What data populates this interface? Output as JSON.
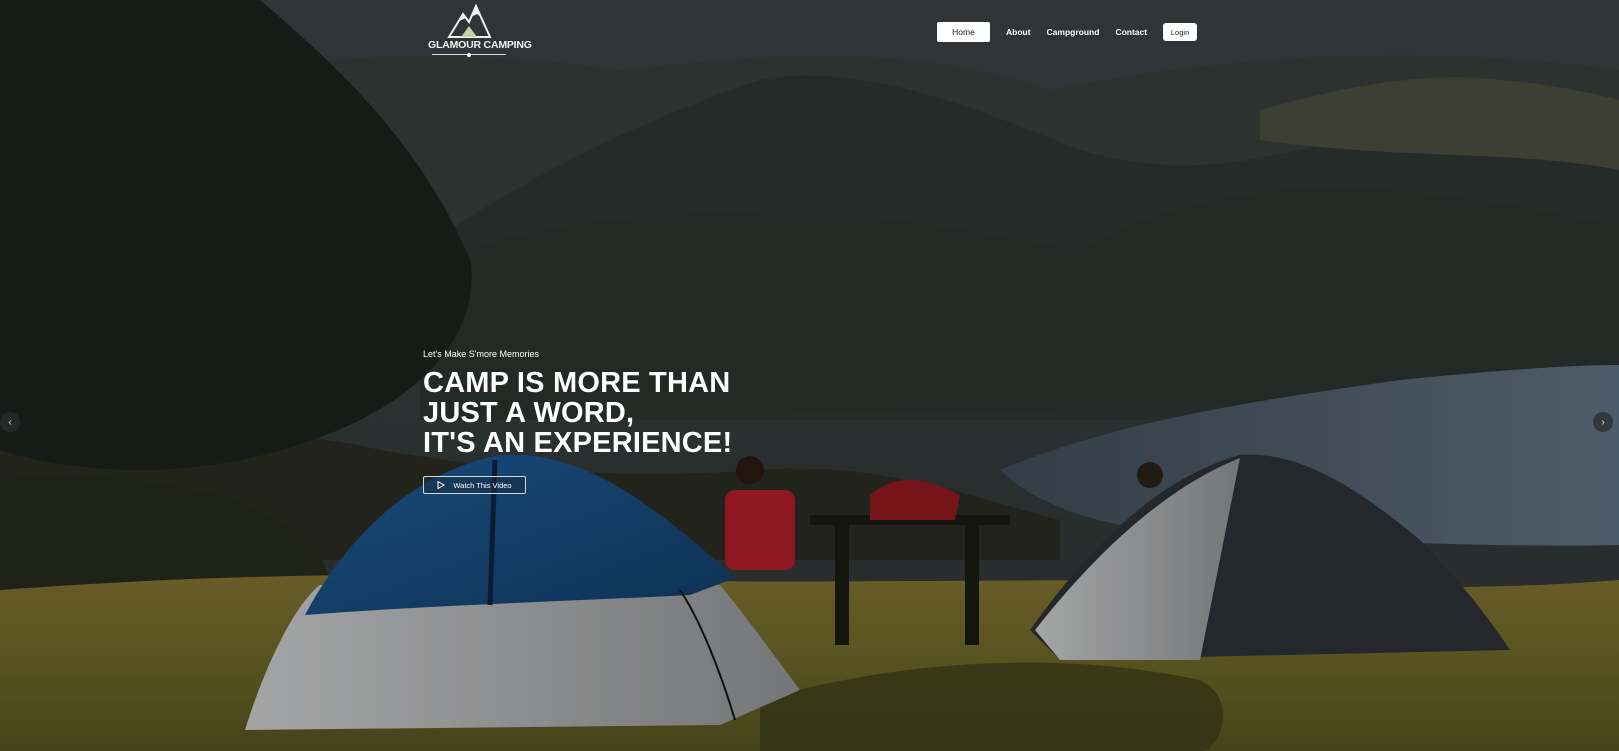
{
  "header": {
    "logo_text": "GLAMOUR CAMPING",
    "logo_icon": "mountain-icon"
  },
  "nav": {
    "items": [
      {
        "label": "Home",
        "active": true
      },
      {
        "label": "About",
        "active": false
      },
      {
        "label": "Campground",
        "active": false
      },
      {
        "label": "Contact",
        "active": false
      }
    ],
    "login_label": "Login"
  },
  "hero": {
    "tagline": "Let's Make S'more Memories",
    "headline_lines": [
      "CAMP IS MORE THAN",
      "JUST A WORD,",
      "IT'S AN EXPERIENCE!"
    ],
    "video_button_label": "Watch This Video",
    "video_button_icon": "play-icon"
  },
  "slider": {
    "prev_icon": "chevron-left-icon",
    "next_icon": "chevron-right-icon",
    "prev_glyph": "‹",
    "next_glyph": "›"
  },
  "colors": {
    "nav_active_bg": "#ffffff",
    "text": "#ffffff",
    "blue_tent": "#1d4f82",
    "grass": "#6b6427"
  }
}
